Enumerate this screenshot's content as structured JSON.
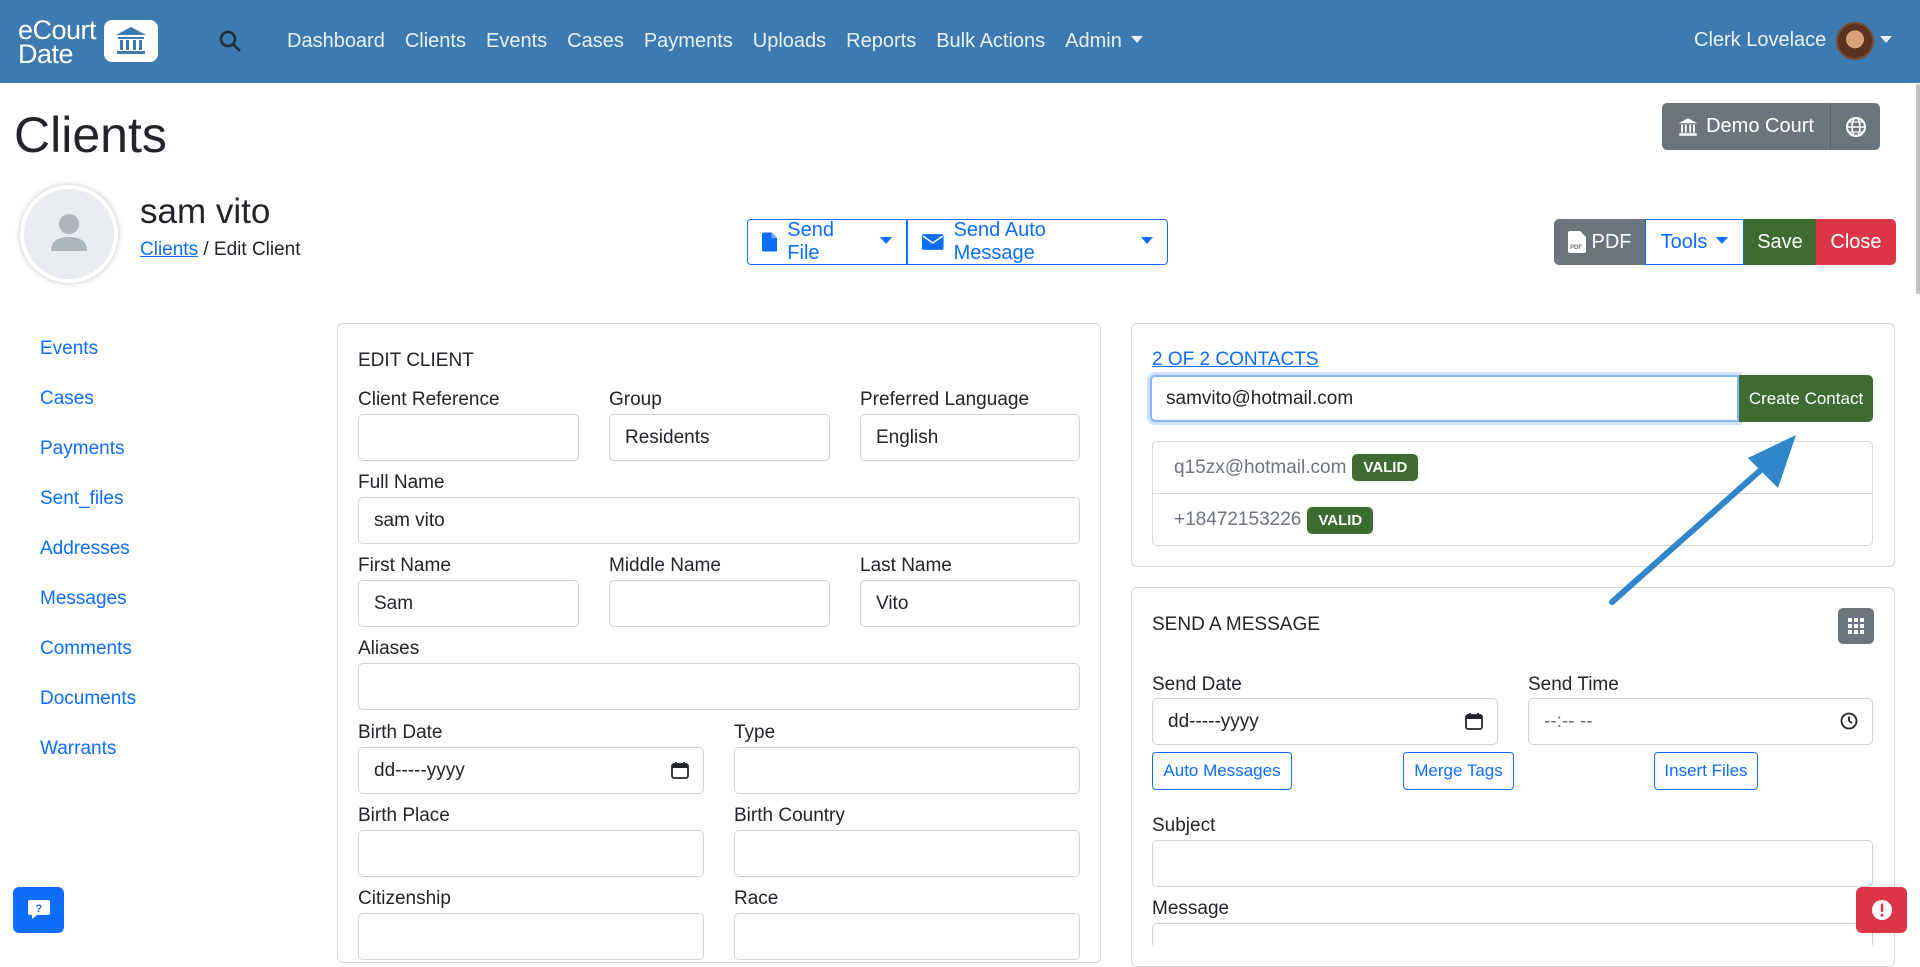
{
  "navbar": {
    "logo_line1": "eCourt",
    "logo_line2": "Date",
    "links": [
      "Dashboard",
      "Clients",
      "Events",
      "Cases",
      "Payments",
      "Uploads",
      "Reports",
      "Bulk Actions",
      "Admin"
    ],
    "user_name": "Clerk Lovelace"
  },
  "page": {
    "title": "Clients",
    "court_label": "Demo Court"
  },
  "client": {
    "name": "sam vito",
    "breadcrumb_link": "Clients",
    "breadcrumb_sep": " / ",
    "breadcrumb_current": "Edit Client"
  },
  "actions": {
    "send_file": "Send File",
    "send_auto_message": "Send Auto Message",
    "pdf": "PDF",
    "tools": "Tools",
    "save": "Save",
    "close": "Close"
  },
  "sidebar": {
    "items": [
      "Events",
      "Cases",
      "Payments",
      "Sent_files",
      "Addresses",
      "Messages",
      "Comments",
      "Documents",
      "Warrants"
    ]
  },
  "edit_client": {
    "title": "EDIT CLIENT",
    "client_reference_label": "Client Reference",
    "client_reference_value": "",
    "group_label": "Group",
    "group_value": "Residents",
    "preferred_language_label": "Preferred Language",
    "preferred_language_value": "English",
    "full_name_label": "Full Name",
    "full_name_value": "sam vito",
    "first_name_label": "First Name",
    "first_name_value": "Sam",
    "middle_name_label": "Middle Name",
    "middle_name_value": "",
    "last_name_label": "Last Name",
    "last_name_value": "Vito",
    "aliases_label": "Aliases",
    "aliases_value": "",
    "birth_date_label": "Birth Date",
    "birth_date_value": "dd-----yyyy",
    "type_label": "Type",
    "type_value": "",
    "birth_place_label": "Birth Place",
    "birth_place_value": "",
    "birth_country_label": "Birth Country",
    "birth_country_value": "",
    "citizenship_label": "Citizenship",
    "race_label": "Race"
  },
  "contacts": {
    "count_link": "2 OF 2 CONTACTS",
    "input_value": "samvito@hotmail.com",
    "create_button": "Create Contact",
    "items": [
      {
        "value": "q15zx@hotmail.com",
        "status": "VALID"
      },
      {
        "value": "+18472153226",
        "status": "VALID"
      }
    ]
  },
  "send_message": {
    "title": "SEND A MESSAGE",
    "send_date_label": "Send Date",
    "send_date_value": "dd-----yyyy",
    "send_time_label": "Send Time",
    "send_time_value": "--:-- --",
    "auto_messages": "Auto Messages",
    "merge_tags": "Merge Tags",
    "insert_files": "Insert Files",
    "subject_label": "Subject",
    "message_label": "Message"
  },
  "colors": {
    "navbar": "#3c7ab0",
    "primary": "#0d6efd",
    "success": "#3e6b2f",
    "danger": "#dc3545",
    "secondary": "#6c757d",
    "annotation_arrow": "#2f86c8"
  }
}
